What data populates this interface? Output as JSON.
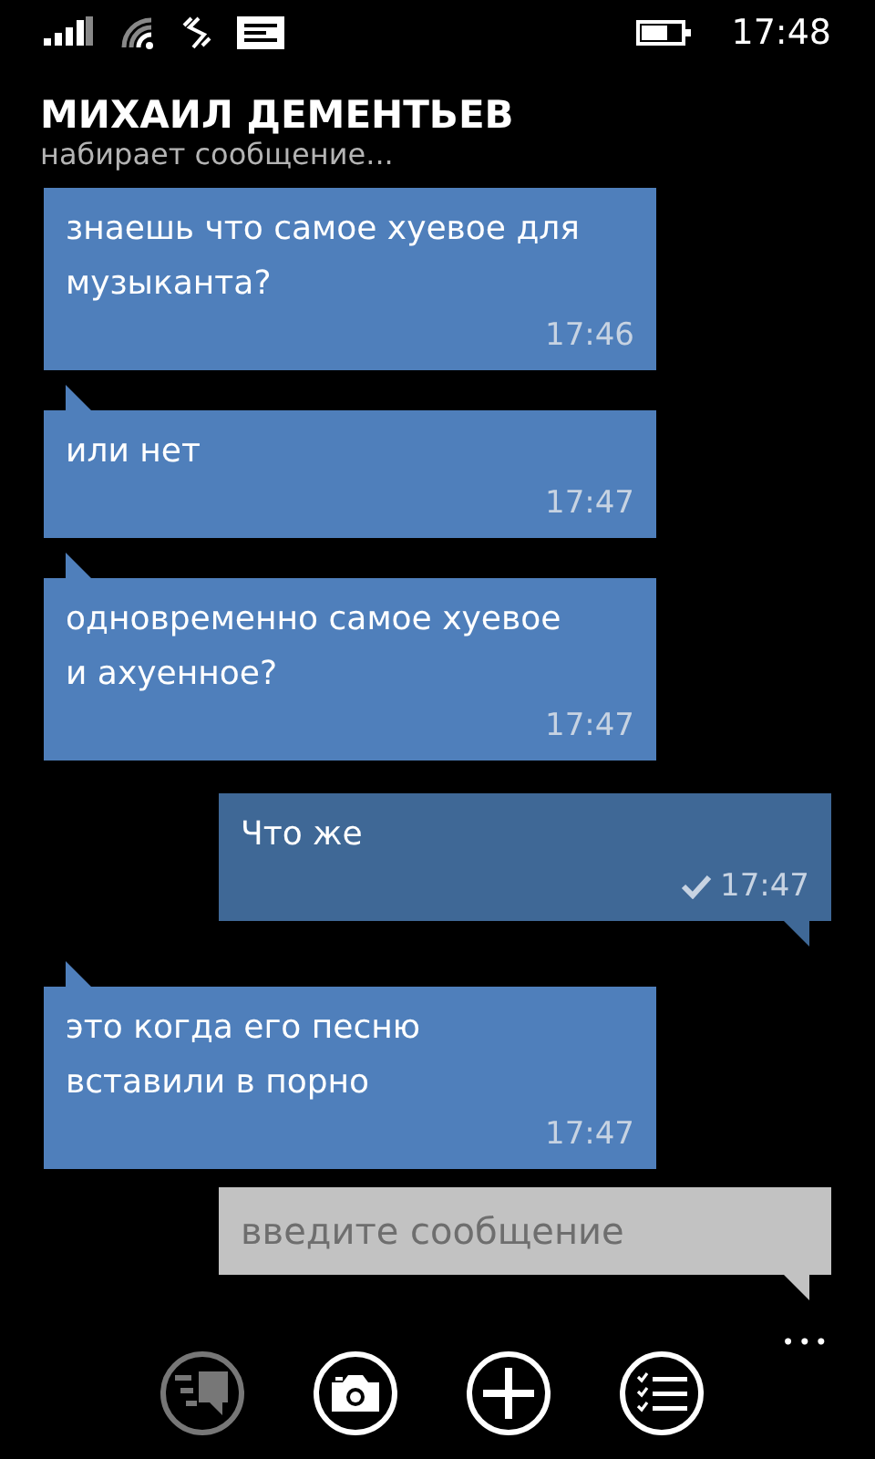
{
  "status_bar": {
    "time": "17:48"
  },
  "header": {
    "name": "МИХАИЛ ДЕМЕНТЬЕВ",
    "status": "набирает сообщение..."
  },
  "messages": [
    {
      "kind": "incoming",
      "tail": false,
      "text": "знаешь что самое хуевое для музыканта?",
      "time": "17:46",
      "delivered": false
    },
    {
      "kind": "incoming",
      "tail": true,
      "text": "или нет",
      "time": "17:47",
      "delivered": false
    },
    {
      "kind": "incoming",
      "tail": true,
      "text": "одновременно самое хуевое и ахуенное?",
      "time": "17:47",
      "delivered": false
    },
    {
      "kind": "outgoing",
      "tail": true,
      "text": "Что же",
      "time": "17:47",
      "delivered": true
    },
    {
      "kind": "incoming",
      "tail": true,
      "text": "это когда его песню вставили в порно",
      "time": "17:47",
      "delivered": false
    }
  ],
  "composer": {
    "placeholder": "введите сообщение"
  },
  "app_bar": {
    "buttons": [
      {
        "kind": "smileys",
        "disabled": true
      },
      {
        "kind": "camera",
        "disabled": false
      },
      {
        "kind": "add",
        "disabled": false
      },
      {
        "kind": "list",
        "disabled": false
      }
    ],
    "more": "•••"
  }
}
